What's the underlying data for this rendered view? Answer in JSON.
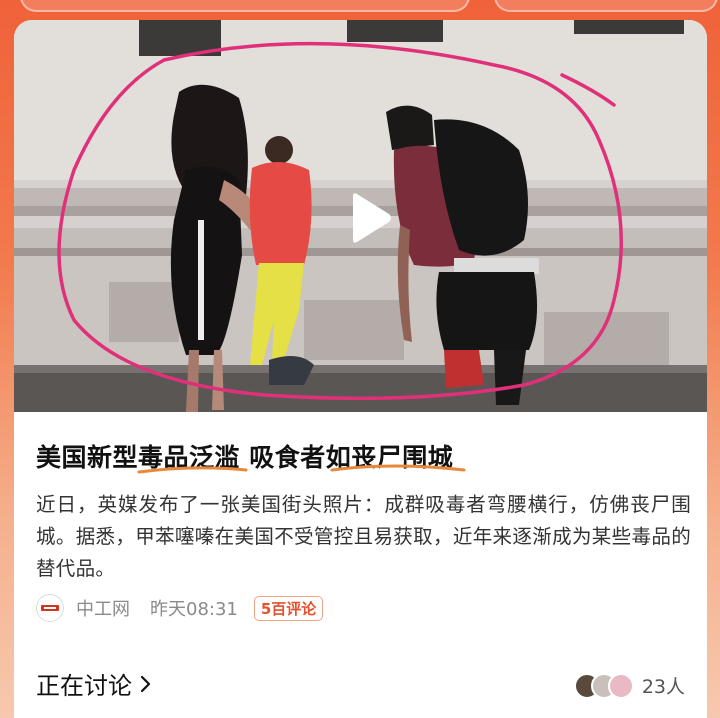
{
  "article": {
    "title": "美国新型毒品泛滥 吸食者如丧尸围城",
    "summary": "近日，英媒发布了一张美国街头照片：成群吸毒者弯腰横行，仿佛丧尸围城。据悉，甲苯噻嗪在美国不受管控且易获取，近年来逐渐成为某些毒品的替代品。",
    "source": "中工网",
    "time": "昨天08:31",
    "comments_badge": "5百评论"
  },
  "discussion": {
    "label": "正在讨论",
    "participants_count": "23人"
  },
  "media": {
    "type": "video",
    "play_icon": "play-icon",
    "annotation_color": "#e0307a"
  },
  "colors": {
    "background_top": "#f0623a",
    "underline": "#e8883a",
    "badge": "#e2522e"
  }
}
